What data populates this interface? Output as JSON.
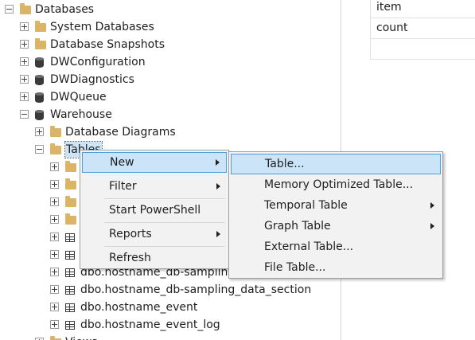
{
  "tree": {
    "items": [
      {
        "label": "Databases",
        "icon": "folder-icon",
        "expander": "minus",
        "indent": 0
      },
      {
        "label": "System Databases",
        "icon": "folder-icon",
        "expander": "plus",
        "indent": 1
      },
      {
        "label": "Database Snapshots",
        "icon": "folder-icon",
        "expander": "plus",
        "indent": 1
      },
      {
        "label": "DWConfiguration",
        "icon": "database-icon",
        "expander": "plus",
        "indent": 1
      },
      {
        "label": "DWDiagnostics",
        "icon": "database-icon",
        "expander": "plus",
        "indent": 1
      },
      {
        "label": "DWQueue",
        "icon": "database-icon",
        "expander": "plus",
        "indent": 1
      },
      {
        "label": "Warehouse",
        "icon": "database-icon",
        "expander": "minus",
        "indent": 1
      },
      {
        "label": "Database Diagrams",
        "icon": "folder-icon",
        "expander": "plus",
        "indent": 2
      },
      {
        "label": "Tables",
        "icon": "folder-icon",
        "expander": "minus",
        "indent": 2,
        "selected": true
      },
      {
        "label": "",
        "icon": "folder-icon",
        "expander": "plus",
        "indent": 3
      },
      {
        "label": "",
        "icon": "folder-icon",
        "expander": "plus",
        "indent": 3
      },
      {
        "label": "",
        "icon": "folder-icon",
        "expander": "plus",
        "indent": 3
      },
      {
        "label": "",
        "icon": "folder-icon",
        "expander": "plus",
        "indent": 3
      },
      {
        "label": "",
        "icon": "table-icon",
        "expander": "plus",
        "indent": 3
      },
      {
        "label": "",
        "icon": "table-icon",
        "expander": "plus",
        "indent": 3
      },
      {
        "label": "dbo.hostname_db-sampling",
        "icon": "table-icon",
        "expander": "plus",
        "indent": 3
      },
      {
        "label": "dbo.hostname_db-sampling_data_section",
        "icon": "table-icon",
        "expander": "plus",
        "indent": 3
      },
      {
        "label": "dbo.hostname_event",
        "icon": "table-icon",
        "expander": "plus",
        "indent": 3
      },
      {
        "label": "dbo.hostname_event_log",
        "icon": "table-icon",
        "expander": "plus",
        "indent": 3
      },
      {
        "label": "Views",
        "icon": "folder-icon",
        "expander": "plus",
        "indent": 2
      }
    ]
  },
  "grid": {
    "cells": [
      "item",
      "count"
    ]
  },
  "context_menu": {
    "items": [
      {
        "label": "New",
        "submenu": true,
        "highlighted": true
      },
      {
        "label": "Filter",
        "submenu": true
      },
      {
        "label": "Start PowerShell",
        "submenu": false
      },
      {
        "label": "Reports",
        "submenu": true
      },
      {
        "label": "Refresh",
        "submenu": false
      }
    ]
  },
  "new_submenu": {
    "items": [
      {
        "label": "Table...",
        "submenu": false,
        "highlighted": true
      },
      {
        "label": "Memory Optimized Table...",
        "submenu": false
      },
      {
        "label": "Temporal Table",
        "submenu": true
      },
      {
        "label": "Graph Table",
        "submenu": true
      },
      {
        "label": "External Table...",
        "submenu": false
      },
      {
        "label": "File Table...",
        "submenu": false
      }
    ]
  },
  "colors": {
    "highlight": "#cce4f7",
    "highlight_border": "#4d9ed8",
    "menu_bg": "#f2f2f2",
    "folder": "#dcb467"
  }
}
